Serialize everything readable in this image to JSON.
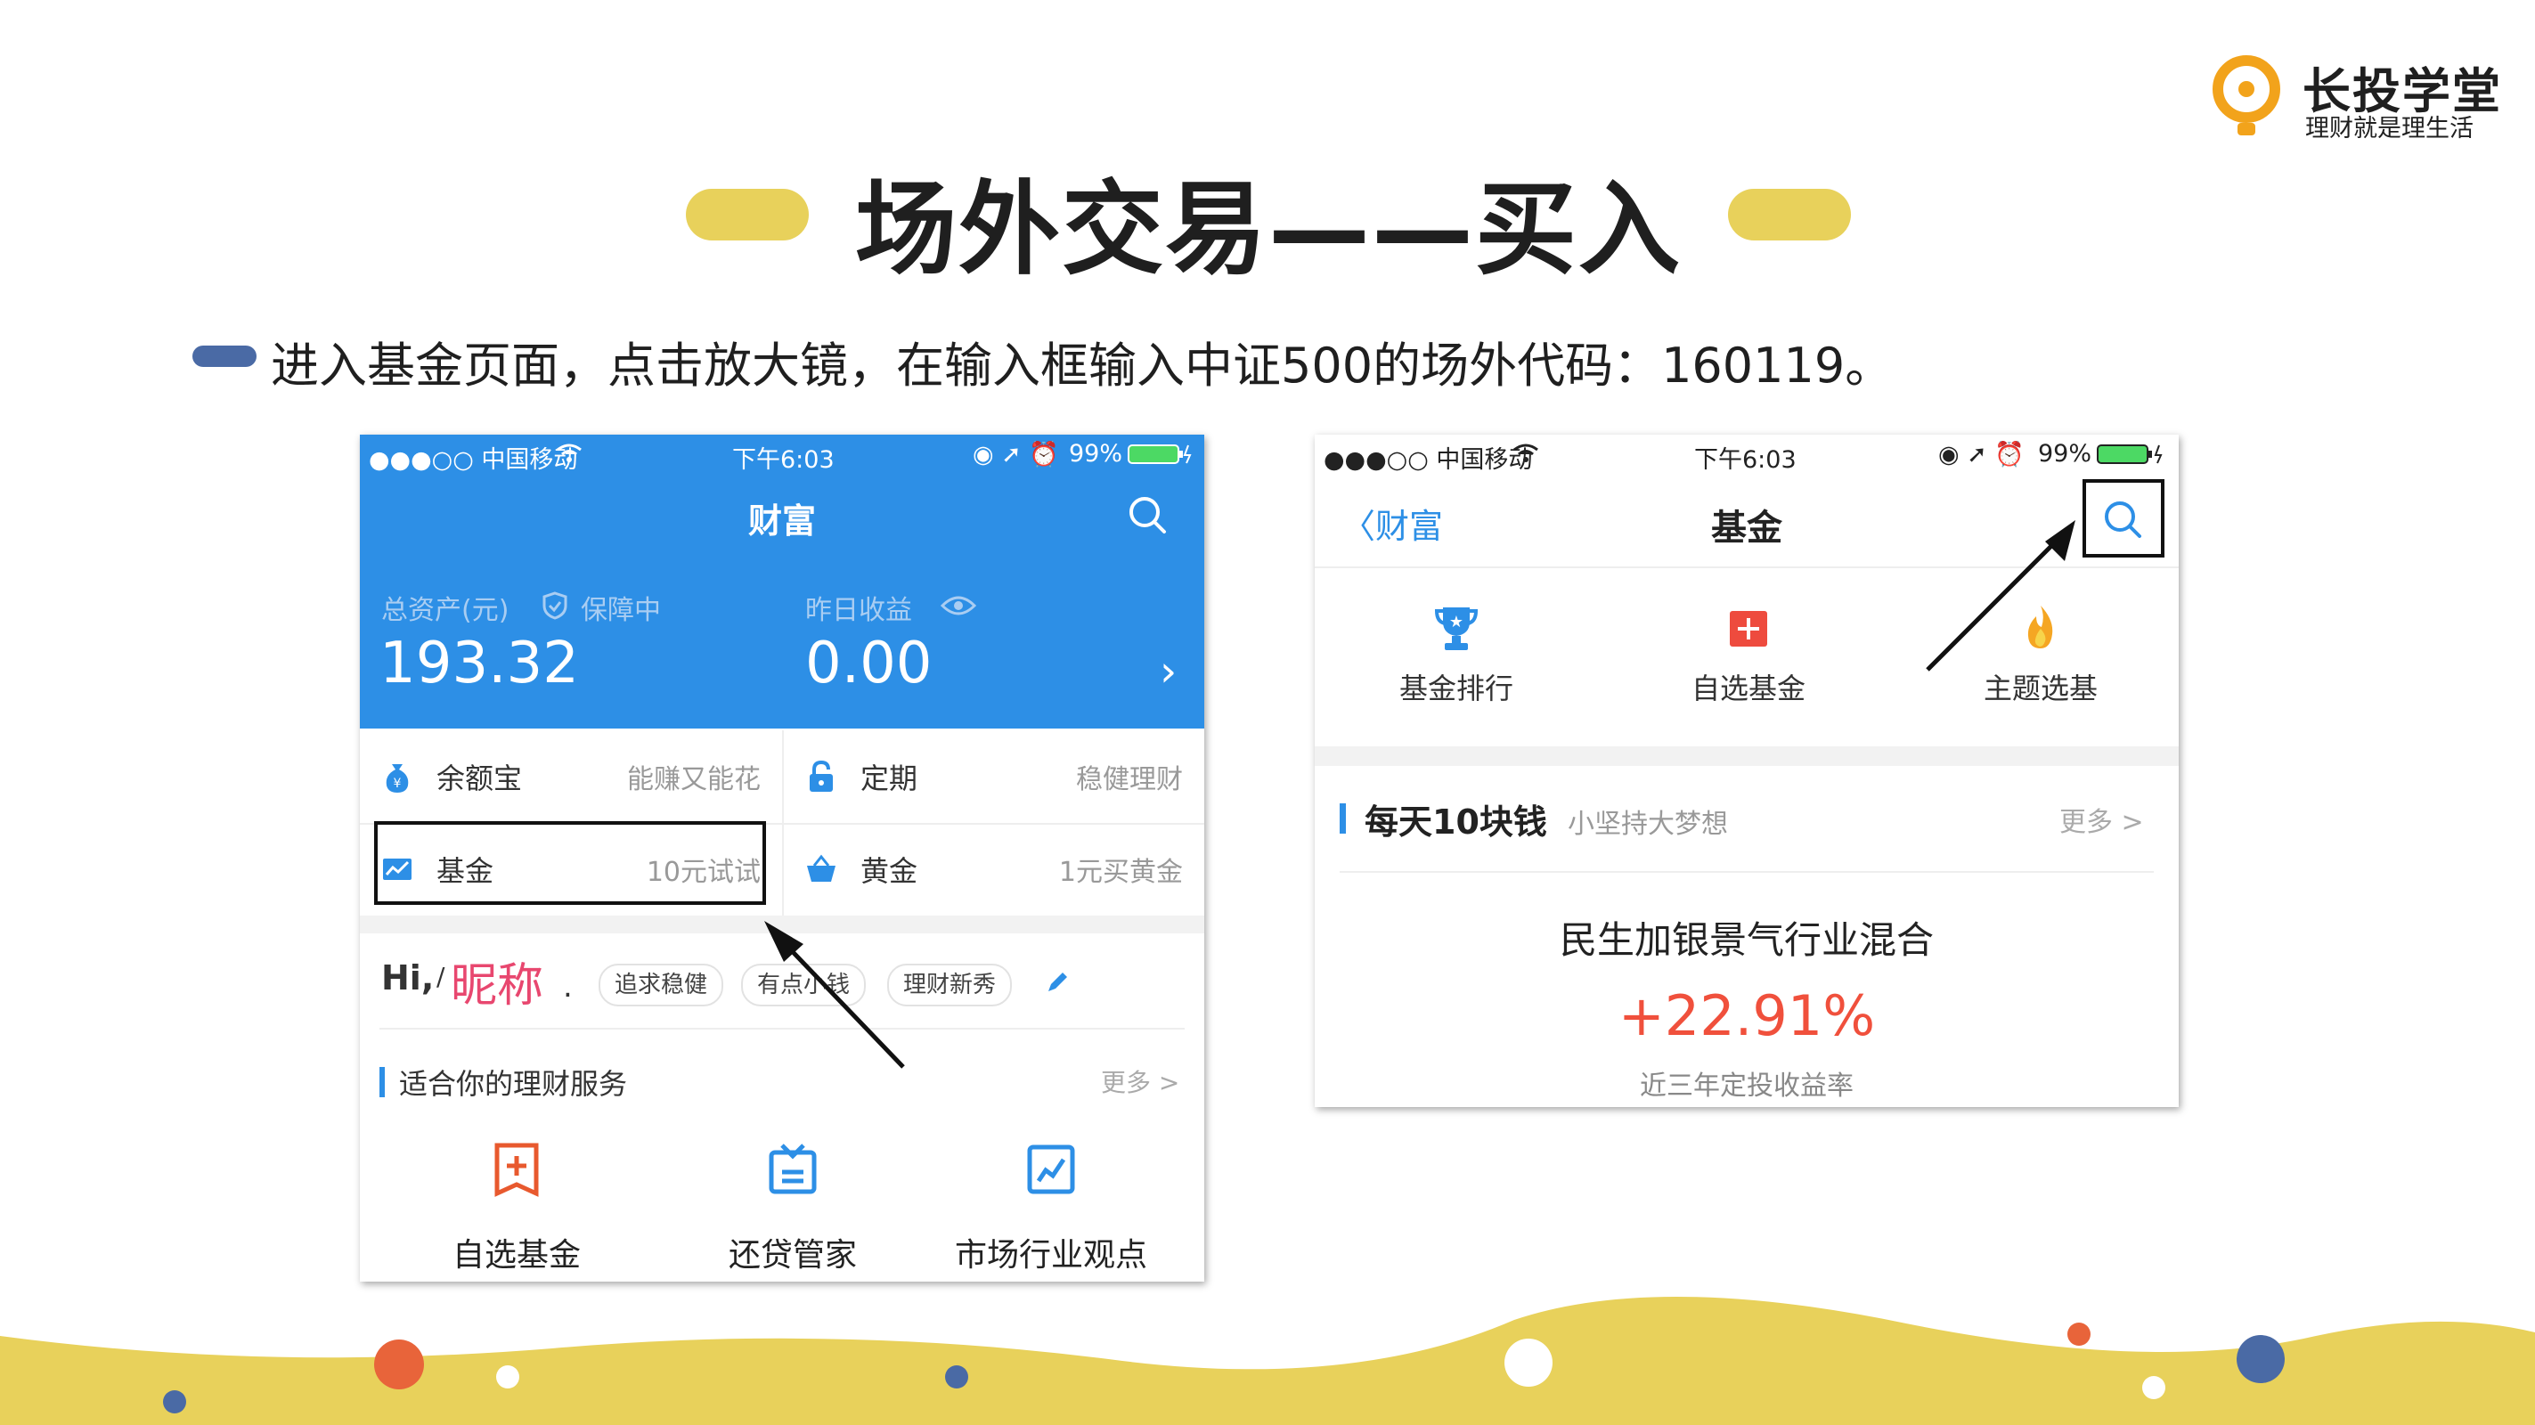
{
  "logo": {
    "name": "长投学堂",
    "slogan": "理财就是理生活"
  },
  "title": "场外交易——买入",
  "instruction": "进入基金页面，点击放大镜，在输入框输入中证500的场外代码：160119。",
  "colors": {
    "accent_yellow": "#e8d15b",
    "bullet_blue": "#4a6aa5",
    "app_blue": "#2d8fe6",
    "return_red": "#f0503c"
  },
  "phone1": {
    "status": {
      "carrier": "●●●○○ 中国移动",
      "time": "下午6:03",
      "battery": "99%"
    },
    "nav_title": "财富",
    "assets": {
      "total_label": "总资产(元)",
      "protect_label": "保障中",
      "total_value": "193.32",
      "yesterday_label": "昨日收益",
      "yesterday_value": "0.00"
    },
    "products": [
      {
        "name": "余额宝",
        "desc": "能赚又能花",
        "icon": "money-bag-icon"
      },
      {
        "name": "定期",
        "desc": "稳健理财",
        "icon": "lock-icon"
      },
      {
        "name": "基金",
        "desc": "10元试试",
        "icon": "chart-icon"
      },
      {
        "name": "黄金",
        "desc": "1元买黄金",
        "icon": "basket-icon"
      }
    ],
    "greeting": {
      "hi": "Hi,",
      "nickname": "昵称",
      "dot": ".",
      "tags": [
        "追求稳健",
        "有点小钱",
        "理财新秀"
      ]
    },
    "services": {
      "title": "适合你的理财服务",
      "more": "更多 >",
      "items": [
        {
          "label": "自选基金",
          "icon": "add-fund-icon"
        },
        {
          "label": "还贷管家",
          "icon": "loan-icon"
        },
        {
          "label": "市场行业观点",
          "icon": "market-icon"
        }
      ]
    }
  },
  "phone2": {
    "status": {
      "carrier": "●●●○○ 中国移动",
      "time": "下午6:03",
      "battery": "99%"
    },
    "back": "财富",
    "nav_title": "基金",
    "shortcuts": [
      {
        "label": "基金排行",
        "icon": "trophy-icon"
      },
      {
        "label": "自选基金",
        "icon": "add-fund-icon"
      },
      {
        "label": "主题选基",
        "icon": "flame-icon"
      }
    ],
    "section": {
      "title": "每天10块钱",
      "subtitle": "小坚持大梦想",
      "more": "更多 >"
    },
    "fund": {
      "name": "民生加银景气行业混合",
      "return": "+22.91%",
      "return_label": "近三年定投收益率"
    }
  }
}
